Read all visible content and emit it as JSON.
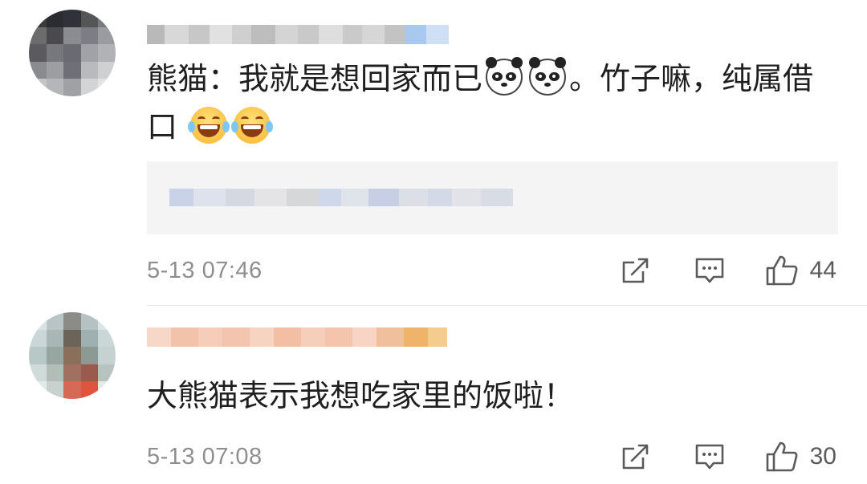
{
  "comments": [
    {
      "text_part1": "熊猫：我就是想回家而已",
      "emoji_a": "panda-emoji",
      "text_part2": "。竹子嘛，纯属借口",
      "emoji_b": "laughing-tears-emoji",
      "timestamp": "5-13 07:46",
      "like_count": "44",
      "has_quote": true
    },
    {
      "text": "大熊猫表示我想吃家里的饭啦！",
      "timestamp": "5-13 07:08",
      "like_count": "30",
      "has_quote": false
    }
  ],
  "icons": {
    "share": "share-icon",
    "comment": "comment-icon",
    "like": "thumbs-up-icon"
  },
  "colors": {
    "meta_text": "#8e8e8e",
    "icon_stroke": "#5a5a5a",
    "quote_bg": "#f4f4f4"
  }
}
